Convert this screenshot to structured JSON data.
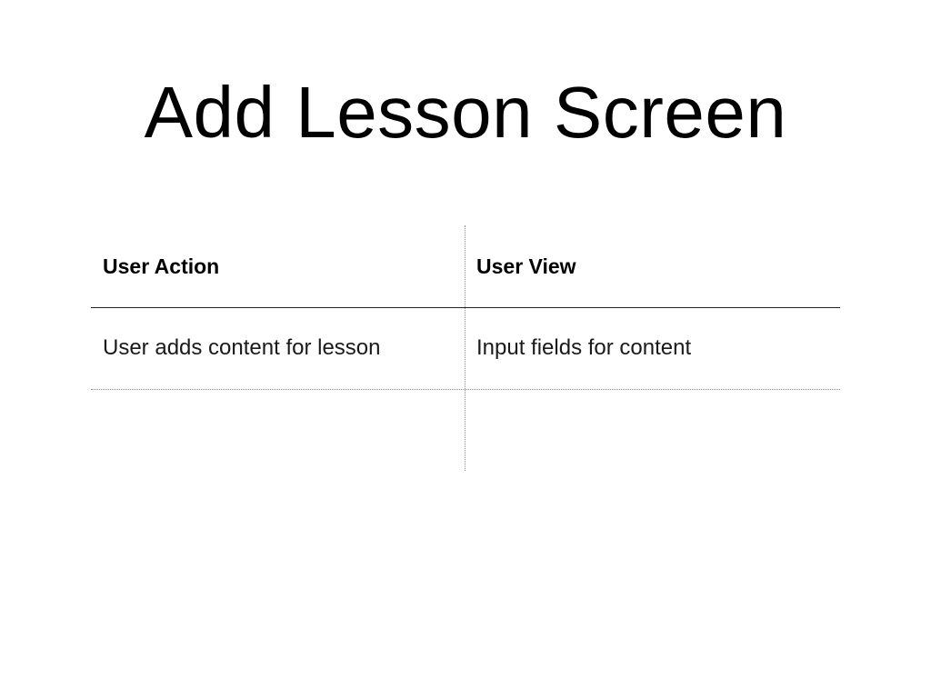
{
  "slide": {
    "title": "Add Lesson Screen"
  },
  "table": {
    "columns": [
      "User Action",
      "User View"
    ],
    "rows": [
      [
        "User adds content for lesson",
        "Input fields for content"
      ],
      [
        "",
        ""
      ]
    ]
  },
  "colors": {
    "background": "#ffffff",
    "text": "#000000",
    "rule": "#222222",
    "dotted_rule": "#8a8a8a"
  }
}
